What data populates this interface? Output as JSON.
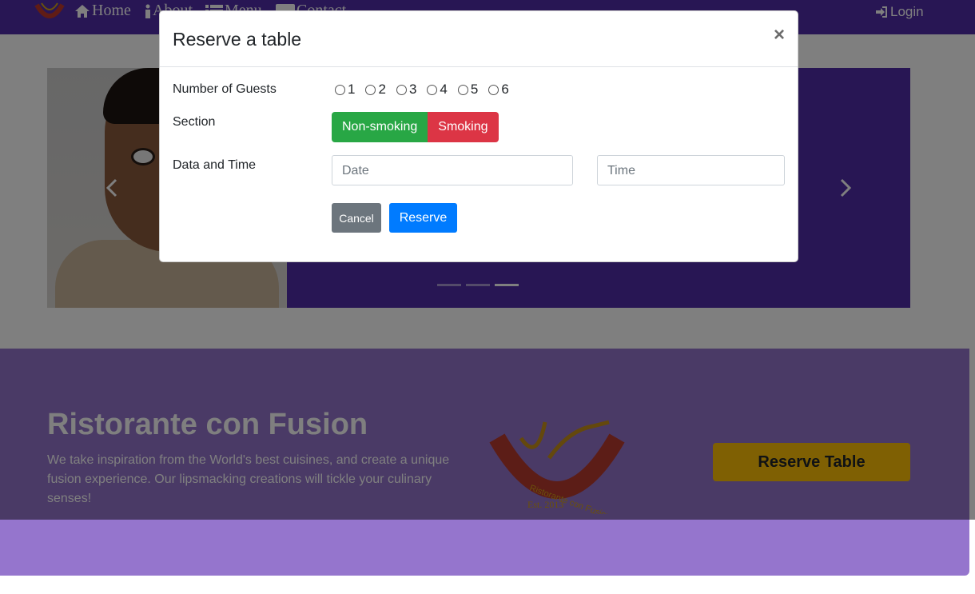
{
  "navbar": {
    "links": [
      {
        "label": "Home",
        "icon": "home-icon"
      },
      {
        "label": "About",
        "icon": "info-icon"
      },
      {
        "label": "Menu",
        "icon": "list-icon"
      },
      {
        "label": "Contact",
        "icon": "address-card-icon"
      }
    ],
    "login_label": "Login"
  },
  "jumbotron": {
    "title": "Ristorante con Fusion",
    "text": "We take inspiration from the World's best cuisines, and create a unique fusion experience. Our lipsmacking creations will tickle your culinary senses!",
    "logo_text": "Ristorante con Fusion",
    "logo_est": "Est. 2013",
    "reserve_button": "Reserve Table"
  },
  "carousel": {
    "indicator_count": 3,
    "active_index": 2
  },
  "modal": {
    "title": "Reserve a table",
    "close_symbol": "×",
    "guests_label": "Number of Guests",
    "guest_options": [
      "1",
      "2",
      "3",
      "4",
      "5",
      "6"
    ],
    "section_label": "Section",
    "section_options": {
      "non_smoking": "Non-smoking",
      "smoking": "Smoking"
    },
    "datetime_label": "Data and Time",
    "date_placeholder": "Date",
    "time_placeholder": "Time",
    "cancel_label": "Cancel",
    "reserve_label": "Reserve"
  },
  "colors": {
    "primary": "#512da8",
    "light_primary": "#9575cd",
    "success": "#28a745",
    "danger": "#dc3545",
    "info": "#007bff",
    "secondary": "#6c757d",
    "warning": "#ffc107"
  }
}
